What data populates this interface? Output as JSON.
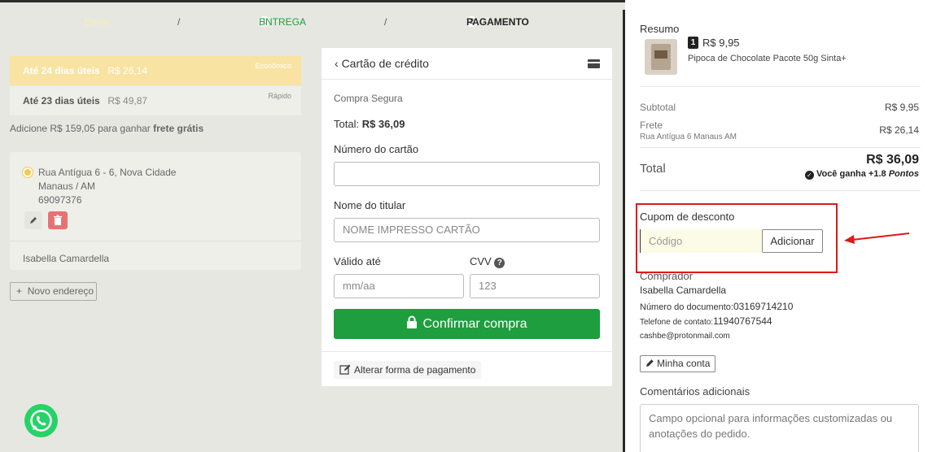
{
  "steps": {
    "step1_label": "Envio",
    "step2_num": "1",
    "step2_label": "ENTREGA",
    "step3_num": "2",
    "step3_label": "PAGAMENTO",
    "separator": "/"
  },
  "shipping": {
    "options": [
      {
        "name": "Até 24 dias úteis",
        "price": "R$ 26,14",
        "tag": "Econômico"
      },
      {
        "name": "Até 23 dias úteis",
        "price": "R$ 49,87",
        "tag": "Rápido"
      }
    ],
    "free_shipping_text": "Adicione R$ 159,05 para ganhar ",
    "free_shipping_bold": "frete grátis"
  },
  "address": {
    "line1": "Rua Antígua 6 - 6, Nova Cidade",
    "line2": "Manaus / AM",
    "zip": "69097376",
    "recipient": "Isabella Camardella",
    "new_address_label": "Novo endereço"
  },
  "payment": {
    "title": "Cartão de crédito",
    "secure_text": "Compra Segura",
    "total_label": "Total: ",
    "total_value": "R$ 36,09",
    "card_number_label": "Número do cartão",
    "card_number_value": "",
    "holder_label": "Nome do titular",
    "holder_placeholder": "NOME IMPRESSO CARTÃO",
    "expiry_label": "Válido até",
    "expiry_placeholder": "mm/aa",
    "cvv_label": "CVV",
    "cvv_placeholder": "123",
    "confirm_label": "Confirmar compra",
    "change_label": "Alterar forma de pagamento"
  },
  "summary": {
    "title": "Resumo",
    "item_qty": "1",
    "item_price": "R$ 9,95",
    "item_name": "Pipoca de Chocolate Pacote 50g Sinta+",
    "subtotal_label": "Subtotal",
    "subtotal_value": "R$ 9,95",
    "freight_label": "Frete",
    "freight_value": "R$ 26,14",
    "freight_address": "Rua Antígua 6 Manaus AM",
    "total_label": "Total",
    "total_value": "R$ 36,09",
    "points_text": "Você ganha +1.8 ",
    "points_word": "Pontos"
  },
  "coupon": {
    "label": "Cupom de desconto",
    "placeholder": "Código",
    "button": "Adicionar"
  },
  "buyer": {
    "title": "Comprador",
    "name": "Isabella Camardella",
    "doc_label": "Número do documento:",
    "doc_value": "03169714210",
    "phone_label": "Telefone de contato:",
    "phone_value": "11940767544",
    "email": "cashbe@protonmail.com",
    "account_button": "Minha conta"
  },
  "comments": {
    "label": "Comentários adicionais",
    "placeholder": "Campo opcional para informações customizadas ou anotações do pedido."
  },
  "colors": {
    "accent_green": "#1e9e3e",
    "highlight_yellow": "#f9e3a2",
    "annotation_red": "#e01818",
    "delete_red": "#e57373"
  }
}
